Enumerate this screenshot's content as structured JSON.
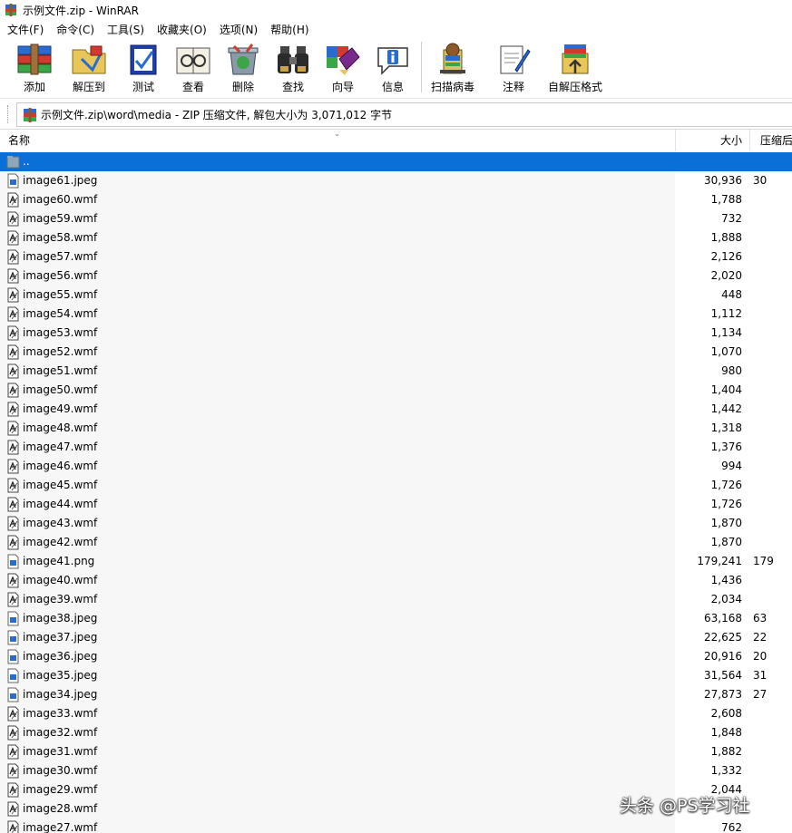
{
  "window": {
    "title": "示例文件.zip - WinRAR"
  },
  "menu": [
    "文件(F)",
    "命令(C)",
    "工具(S)",
    "收藏夹(O)",
    "选项(N)",
    "帮助(H)"
  ],
  "toolbar": [
    {
      "label": "添加",
      "icon": "add-archive-icon"
    },
    {
      "label": "解压到",
      "icon": "extract-to-icon"
    },
    {
      "label": "测试",
      "icon": "test-icon"
    },
    {
      "label": "查看",
      "icon": "view-icon"
    },
    {
      "label": "删除",
      "icon": "delete-icon"
    },
    {
      "label": "查找",
      "icon": "find-icon"
    },
    {
      "label": "向导",
      "icon": "wizard-icon"
    },
    {
      "label": "信息",
      "icon": "info-icon"
    },
    {
      "label": "扫描病毒",
      "icon": "virus-scan-icon"
    },
    {
      "label": "注释",
      "icon": "comment-icon"
    },
    {
      "label": "自解压格式",
      "icon": "sfx-icon"
    }
  ],
  "address": {
    "text": "示例文件.zip\\word\\media - ZIP 压缩文件, 解包大小为 3,071,012 字节"
  },
  "columns": {
    "name": "名称",
    "size": "大小",
    "packed": "压缩后"
  },
  "files": [
    {
      "name": "..",
      "size": "",
      "packed": "",
      "type": "folder-up"
    },
    {
      "name": "image61.jpeg",
      "size": "30,936",
      "packed": "30",
      "type": "image"
    },
    {
      "name": "image60.wmf",
      "size": "1,788",
      "packed": "",
      "type": "wmf"
    },
    {
      "name": "image59.wmf",
      "size": "732",
      "packed": "",
      "type": "wmf"
    },
    {
      "name": "image58.wmf",
      "size": "1,888",
      "packed": "",
      "type": "wmf"
    },
    {
      "name": "image57.wmf",
      "size": "2,126",
      "packed": "",
      "type": "wmf"
    },
    {
      "name": "image56.wmf",
      "size": "2,020",
      "packed": "",
      "type": "wmf"
    },
    {
      "name": "image55.wmf",
      "size": "448",
      "packed": "",
      "type": "wmf"
    },
    {
      "name": "image54.wmf",
      "size": "1,112",
      "packed": "",
      "type": "wmf"
    },
    {
      "name": "image53.wmf",
      "size": "1,134",
      "packed": "",
      "type": "wmf"
    },
    {
      "name": "image52.wmf",
      "size": "1,070",
      "packed": "",
      "type": "wmf"
    },
    {
      "name": "image51.wmf",
      "size": "980",
      "packed": "",
      "type": "wmf"
    },
    {
      "name": "image50.wmf",
      "size": "1,404",
      "packed": "",
      "type": "wmf"
    },
    {
      "name": "image49.wmf",
      "size": "1,442",
      "packed": "",
      "type": "wmf"
    },
    {
      "name": "image48.wmf",
      "size": "1,318",
      "packed": "",
      "type": "wmf"
    },
    {
      "name": "image47.wmf",
      "size": "1,376",
      "packed": "",
      "type": "wmf"
    },
    {
      "name": "image46.wmf",
      "size": "994",
      "packed": "",
      "type": "wmf"
    },
    {
      "name": "image45.wmf",
      "size": "1,726",
      "packed": "",
      "type": "wmf"
    },
    {
      "name": "image44.wmf",
      "size": "1,726",
      "packed": "",
      "type": "wmf"
    },
    {
      "name": "image43.wmf",
      "size": "1,870",
      "packed": "",
      "type": "wmf"
    },
    {
      "name": "image42.wmf",
      "size": "1,870",
      "packed": "",
      "type": "wmf"
    },
    {
      "name": "image41.png",
      "size": "179,241",
      "packed": "179",
      "type": "image"
    },
    {
      "name": "image40.wmf",
      "size": "1,436",
      "packed": "",
      "type": "wmf"
    },
    {
      "name": "image39.wmf",
      "size": "2,034",
      "packed": "",
      "type": "wmf"
    },
    {
      "name": "image38.jpeg",
      "size": "63,168",
      "packed": "63",
      "type": "image"
    },
    {
      "name": "image37.jpeg",
      "size": "22,625",
      "packed": "22",
      "type": "image"
    },
    {
      "name": "image36.jpeg",
      "size": "20,916",
      "packed": "20",
      "type": "image"
    },
    {
      "name": "image35.jpeg",
      "size": "31,564",
      "packed": "31",
      "type": "image"
    },
    {
      "name": "image34.jpeg",
      "size": "27,873",
      "packed": "27",
      "type": "image"
    },
    {
      "name": "image33.wmf",
      "size": "2,608",
      "packed": "",
      "type": "wmf"
    },
    {
      "name": "image32.wmf",
      "size": "1,848",
      "packed": "",
      "type": "wmf"
    },
    {
      "name": "image31.wmf",
      "size": "1,882",
      "packed": "",
      "type": "wmf"
    },
    {
      "name": "image30.wmf",
      "size": "1,332",
      "packed": "",
      "type": "wmf"
    },
    {
      "name": "image29.wmf",
      "size": "2,044",
      "packed": "",
      "type": "wmf"
    },
    {
      "name": "image28.wmf",
      "size": "",
      "packed": "",
      "type": "wmf"
    },
    {
      "name": "image27.wmf",
      "size": "762",
      "packed": "",
      "type": "wmf"
    }
  ],
  "selected_row": 0,
  "watermark": "头条 @PS学习社",
  "colors": {
    "selection": "#0a6fd6",
    "name_column_bg": "#f7f7f7"
  }
}
